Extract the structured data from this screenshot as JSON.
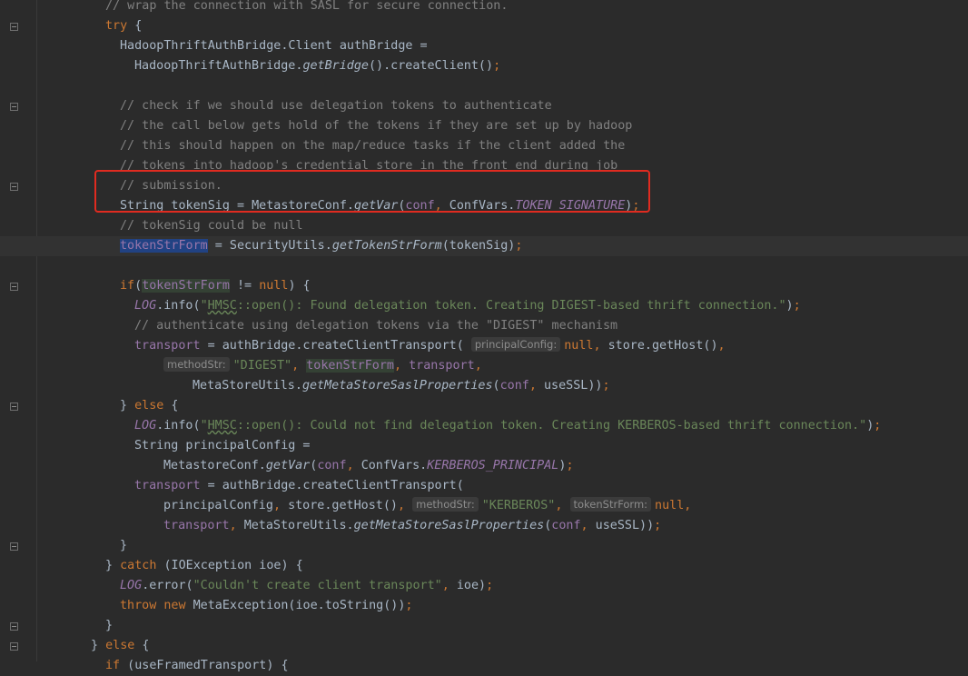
{
  "editor": {
    "lines": [
      {
        "indent": 116,
        "parts": [
          {
            "t": "// wrap the connection with SASL for secure connection.",
            "c": "cmt"
          }
        ]
      },
      {
        "indent": 116,
        "parts": [
          {
            "t": "try",
            "c": "kw"
          },
          {
            "t": " {"
          }
        ]
      },
      {
        "indent": 132,
        "parts": [
          {
            "t": "HadoopThriftAuthBridge.Client authBridge ="
          }
        ]
      },
      {
        "indent": 148,
        "parts": [
          {
            "t": "HadoopThriftAuthBridge."
          },
          {
            "t": "getBridge",
            "c": "ital"
          },
          {
            "t": "().createClient()"
          },
          {
            "t": ";",
            "c": "kw"
          }
        ]
      },
      {
        "indent": 132,
        "parts": []
      },
      {
        "indent": 132,
        "parts": [
          {
            "t": "// check if we should use delegation tokens to authenticate",
            "c": "cmt"
          }
        ]
      },
      {
        "indent": 132,
        "parts": [
          {
            "t": "// the call below gets hold of the tokens if they are set up by hadoop",
            "c": "cmt"
          }
        ]
      },
      {
        "indent": 132,
        "parts": [
          {
            "t": "// this should happen on the map/reduce tasks if the client added the",
            "c": "cmt"
          }
        ]
      },
      {
        "indent": 132,
        "parts": [
          {
            "t": "// tokens into hadoop's credential store in the front end during job",
            "c": "cmt"
          }
        ]
      },
      {
        "indent": 132,
        "parts": [
          {
            "t": "// submission.",
            "c": "cmt"
          }
        ]
      },
      {
        "indent": 132,
        "parts": [
          {
            "t": "String tokenSig = MetastoreConf."
          },
          {
            "t": "getVar",
            "c": "ital"
          },
          {
            "t": "("
          },
          {
            "t": "conf",
            "c": "fldp"
          },
          {
            "t": ", ",
            "c": "kw"
          },
          {
            "t": "ConfVars."
          },
          {
            "t": "TOKEN_SIGNATURE",
            "c": "fld"
          },
          {
            "t": ")"
          },
          {
            "t": ";",
            "c": "kw"
          }
        ]
      },
      {
        "indent": 132,
        "parts": [
          {
            "t": "// tokenSig could be null",
            "c": "cmt"
          }
        ]
      },
      {
        "indent": 132,
        "current": true,
        "parts": [
          {
            "t": "tokenStrForm",
            "c": "local sel"
          },
          {
            "t": " = SecurityUtils."
          },
          {
            "t": "getTokenStrForm",
            "c": "ital"
          },
          {
            "t": "(tokenSig)"
          },
          {
            "t": ";",
            "c": "kw"
          }
        ]
      },
      {
        "indent": 132,
        "parts": []
      },
      {
        "indent": 132,
        "parts": [
          {
            "t": "if",
            "c": "kw"
          },
          {
            "t": "("
          },
          {
            "t": "tokenStrForm",
            "c": "local usage"
          },
          {
            "t": " != "
          },
          {
            "t": "null",
            "c": "kw"
          },
          {
            "t": ") {"
          }
        ]
      },
      {
        "indent": 148,
        "parts": [
          {
            "t": "LOG",
            "c": "static"
          },
          {
            "t": ".info("
          },
          {
            "t": "\"",
            "c": "str"
          },
          {
            "t": "HMSC",
            "c": "str squig"
          },
          {
            "t": "::open(): Found delegation token. Creating DIGEST-based thrift connection.\"",
            "c": "str"
          },
          {
            "t": ")"
          },
          {
            "t": ";",
            "c": "kw"
          }
        ]
      },
      {
        "indent": 148,
        "parts": [
          {
            "t": "// authenticate using delegation tokens via the \"DIGEST\" mechanism",
            "c": "cmt"
          }
        ]
      },
      {
        "indent": 148,
        "parts": [
          {
            "t": "transport",
            "c": "local"
          },
          {
            "t": " = authBridge.createClientTransport( "
          },
          {
            "t": "principalConfig:",
            "c": "hint"
          },
          {
            "t": "null",
            "c": "kw"
          },
          {
            "t": ", ",
            "c": "kw"
          },
          {
            "t": "store.getHost()"
          },
          {
            "t": ",",
            "c": "kw"
          }
        ]
      },
      {
        "indent": 180,
        "parts": [
          {
            "t": "methodStr:",
            "c": "hint"
          },
          {
            "t": "\"DIGEST\"",
            "c": "str"
          },
          {
            "t": ", ",
            "c": "kw"
          },
          {
            "t": "tokenStrForm",
            "c": "local usage"
          },
          {
            "t": ", ",
            "c": "kw"
          },
          {
            "t": "transport",
            "c": "local"
          },
          {
            "t": ",",
            "c": "kw"
          }
        ]
      },
      {
        "indent": 212,
        "parts": [
          {
            "t": "MetaStoreUtils."
          },
          {
            "t": "getMetaStoreSaslProperties",
            "c": "ital"
          },
          {
            "t": "("
          },
          {
            "t": "conf",
            "c": "fldp"
          },
          {
            "t": ", ",
            "c": "kw"
          },
          {
            "t": "useSSL))"
          },
          {
            "t": ";",
            "c": "kw"
          }
        ]
      },
      {
        "indent": 132,
        "parts": [
          {
            "t": "} "
          },
          {
            "t": "else",
            "c": "kw"
          },
          {
            "t": " {"
          }
        ]
      },
      {
        "indent": 148,
        "parts": [
          {
            "t": "LOG",
            "c": "static"
          },
          {
            "t": ".info("
          },
          {
            "t": "\"",
            "c": "str"
          },
          {
            "t": "HMSC",
            "c": "str squig"
          },
          {
            "t": "::open(): Could not find delegation token. Creating KERBEROS-based thrift connection.\"",
            "c": "str"
          },
          {
            "t": ")"
          },
          {
            "t": ";",
            "c": "kw"
          }
        ]
      },
      {
        "indent": 148,
        "parts": [
          {
            "t": "String principalConfig ="
          }
        ]
      },
      {
        "indent": 180,
        "parts": [
          {
            "t": "MetastoreConf."
          },
          {
            "t": "getVar",
            "c": "ital"
          },
          {
            "t": "("
          },
          {
            "t": "conf",
            "c": "fldp"
          },
          {
            "t": ", ",
            "c": "kw"
          },
          {
            "t": "ConfVars."
          },
          {
            "t": "KERBEROS_PRINCIPAL",
            "c": "fld"
          },
          {
            "t": ")"
          },
          {
            "t": ";",
            "c": "kw"
          }
        ]
      },
      {
        "indent": 148,
        "parts": [
          {
            "t": "transport",
            "c": "local"
          },
          {
            "t": " = authBridge.createClientTransport("
          }
        ]
      },
      {
        "indent": 180,
        "parts": [
          {
            "t": "principalConfig"
          },
          {
            "t": ", ",
            "c": "kw"
          },
          {
            "t": "store.getHost()"
          },
          {
            "t": ", ",
            "c": "kw"
          },
          {
            "t": "methodStr:",
            "c": "hint"
          },
          {
            "t": "\"KERBEROS\"",
            "c": "str"
          },
          {
            "t": ", ",
            "c": "kw"
          },
          {
            "t": "tokenStrForm:",
            "c": "hint"
          },
          {
            "t": "null",
            "c": "kw"
          },
          {
            "t": ",",
            "c": "kw"
          }
        ]
      },
      {
        "indent": 180,
        "parts": [
          {
            "t": "transport",
            "c": "local"
          },
          {
            "t": ", ",
            "c": "kw"
          },
          {
            "t": "MetaStoreUtils."
          },
          {
            "t": "getMetaStoreSaslProperties",
            "c": "ital"
          },
          {
            "t": "("
          },
          {
            "t": "conf",
            "c": "fldp"
          },
          {
            "t": ", ",
            "c": "kw"
          },
          {
            "t": "useSSL))"
          },
          {
            "t": ";",
            "c": "kw"
          }
        ]
      },
      {
        "indent": 132,
        "parts": [
          {
            "t": "}"
          }
        ]
      },
      {
        "indent": 116,
        "parts": [
          {
            "t": "} "
          },
          {
            "t": "catch",
            "c": "kw"
          },
          {
            "t": " (IOException ioe) {"
          }
        ]
      },
      {
        "indent": 132,
        "parts": [
          {
            "t": "LOG",
            "c": "static"
          },
          {
            "t": ".error("
          },
          {
            "t": "\"Couldn't create client transport\"",
            "c": "str"
          },
          {
            "t": ", ",
            "c": "kw"
          },
          {
            "t": "ioe)"
          },
          {
            "t": ";",
            "c": "kw"
          }
        ]
      },
      {
        "indent": 132,
        "parts": [
          {
            "t": "throw new ",
            "c": "kw"
          },
          {
            "t": "MetaException(ioe.toString())"
          },
          {
            "t": ";",
            "c": "kw"
          }
        ]
      },
      {
        "indent": 116,
        "parts": [
          {
            "t": "}"
          }
        ]
      },
      {
        "indent": 100,
        "parts": [
          {
            "t": "} "
          },
          {
            "t": "else",
            "c": "kw"
          },
          {
            "t": " {"
          }
        ]
      },
      {
        "indent": 116,
        "parts": [
          {
            "t": "if",
            "c": "kw"
          },
          {
            "t": " (useFramedTransport) {"
          }
        ]
      }
    ],
    "fold_rows": [
      1,
      5,
      9,
      14,
      20,
      27,
      31,
      32
    ]
  }
}
